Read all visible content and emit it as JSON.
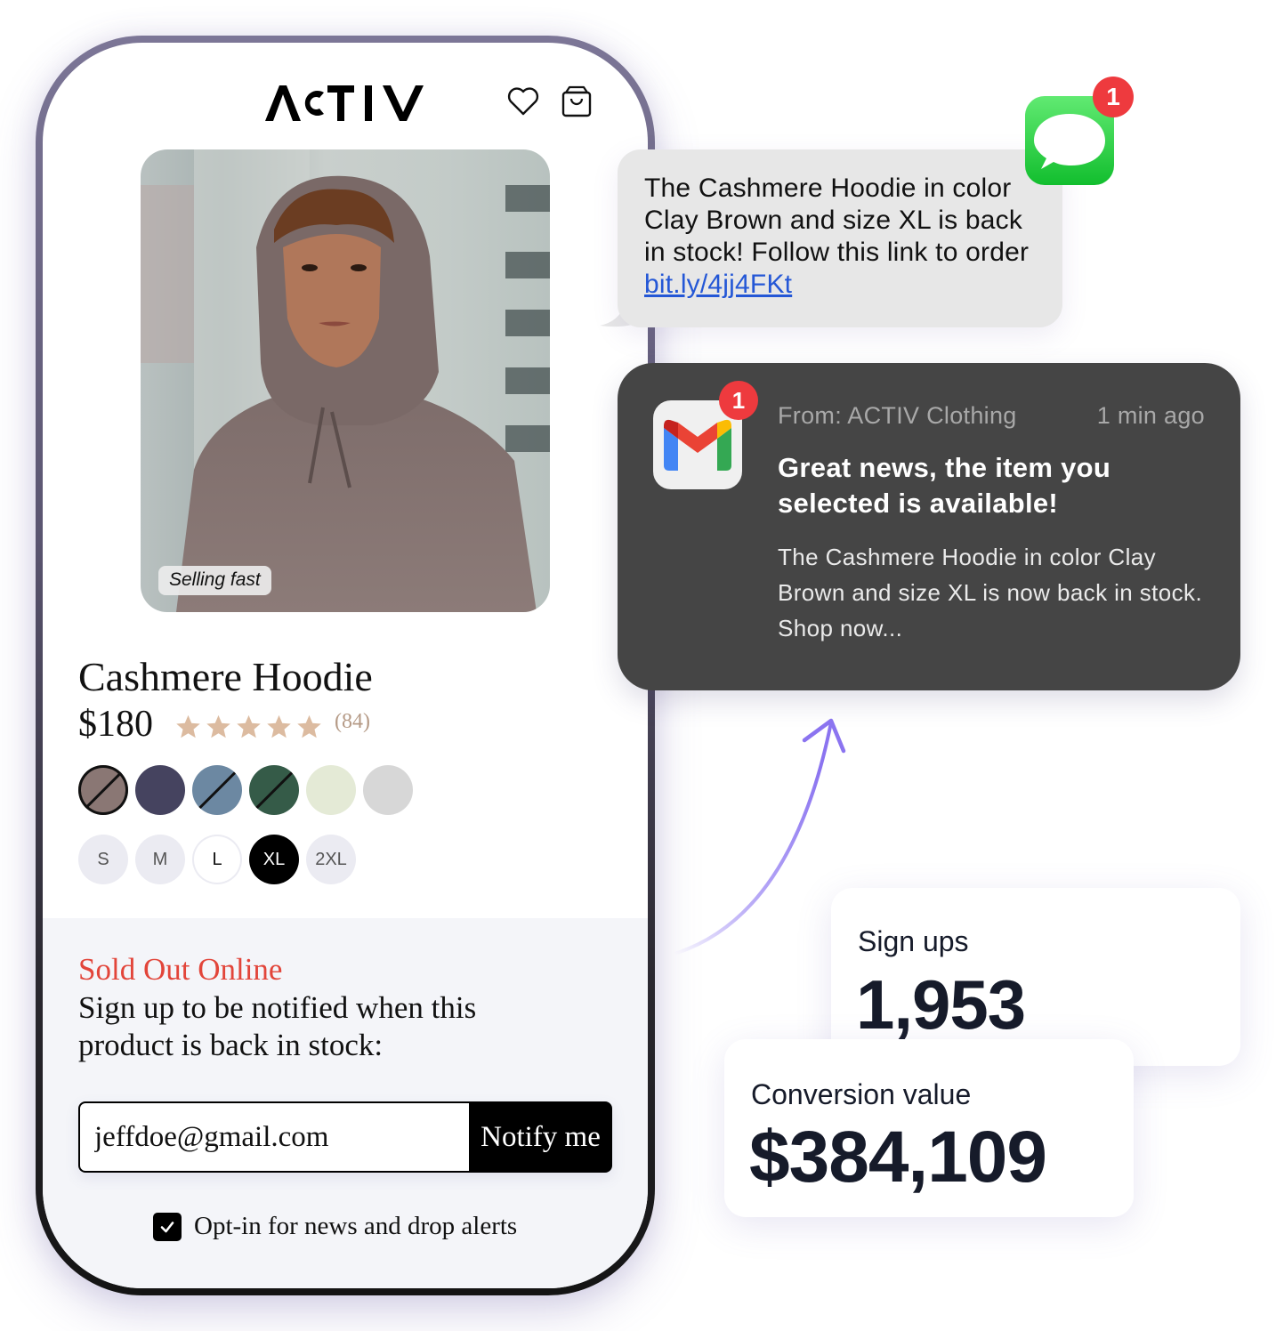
{
  "store": {
    "brand": "ACTIV",
    "header_icons": [
      "heart-icon",
      "shopping-bag-icon"
    ]
  },
  "product": {
    "image_badge": "Selling fast",
    "name": "Cashmere Hoodie",
    "price": "$180",
    "rating": 5,
    "rating_max": 5,
    "review_count": "(84)",
    "colors": [
      {
        "name": "Clay Brown",
        "hex": "#8a7774",
        "selected": true,
        "sold_out": true
      },
      {
        "name": "Navy",
        "hex": "#45435f",
        "selected": false,
        "sold_out": false
      },
      {
        "name": "Slate Blue",
        "hex": "#6c88a2",
        "selected": false,
        "sold_out": true
      },
      {
        "name": "Forest Green",
        "hex": "#355b48",
        "selected": false,
        "sold_out": true
      },
      {
        "name": "Sage",
        "hex": "#e4ead6",
        "selected": false,
        "sold_out": false
      },
      {
        "name": "Light Gray",
        "hex": "#d7d7d7",
        "selected": false,
        "sold_out": false
      }
    ],
    "sizes": [
      {
        "label": "S",
        "state": "unavailable"
      },
      {
        "label": "M",
        "state": "unavailable"
      },
      {
        "label": "L",
        "state": "available"
      },
      {
        "label": "XL",
        "state": "selected"
      },
      {
        "label": "2XL",
        "state": "unavailable"
      }
    ]
  },
  "back_in_stock": {
    "status": "Sold Out Online",
    "prompt": "Sign up to be notified when this product is back in stock:",
    "email_value": "jeffdoe@gmail.com",
    "button_label": "Notify me",
    "optin_label": "Opt-in for news and drop alerts",
    "optin_checked": true
  },
  "sms": {
    "badge_count": "1",
    "text": "The Cashmere Hoodie in color Clay Brown and size XL is back in stock! Follow this link to order",
    "link": "bit.ly/4jj4FKt"
  },
  "email_notification": {
    "badge_count": "1",
    "from": "From: ACTIV Clothing",
    "time": "1 min ago",
    "subject": "Great news, the item you selected is available!",
    "preview": "The Cashmere Hoodie in color Clay Brown and size XL is now back in stock. Shop now..."
  },
  "stats": {
    "signups_label": "Sign ups",
    "signups_value": "1,953",
    "conversion_label": "Conversion value",
    "conversion_value": "$384,109"
  },
  "colors": {
    "sold_out_red": "#e2453a",
    "star": "#dcbba0",
    "link_blue": "#2457d6",
    "notification_bg": "#454545",
    "badge_red": "#ee3a3e",
    "arrow_purple": "#8b74f0"
  }
}
